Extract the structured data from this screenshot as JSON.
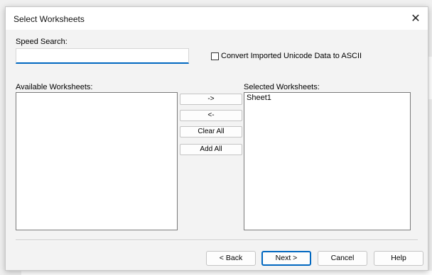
{
  "window": {
    "title": "Select Worksheets"
  },
  "speed_search": {
    "label": "Speed Search:",
    "value": ""
  },
  "convert_unicode": {
    "label": "Convert Imported Unicode Data to ASCII",
    "checked": false
  },
  "available": {
    "label": "Available Worksheets:",
    "items": []
  },
  "selected": {
    "label": "Selected Worksheets:",
    "items": [
      "Sheet1"
    ]
  },
  "transfer_buttons": {
    "add": "->",
    "remove": "<-",
    "clear_all": "Clear All",
    "add_all": "Add All"
  },
  "footer": {
    "back": "< Back",
    "next": "Next >",
    "cancel": "Cancel",
    "help": "Help"
  },
  "icons": {
    "close": "close-icon"
  },
  "colors": {
    "accent": "#0067c0"
  }
}
